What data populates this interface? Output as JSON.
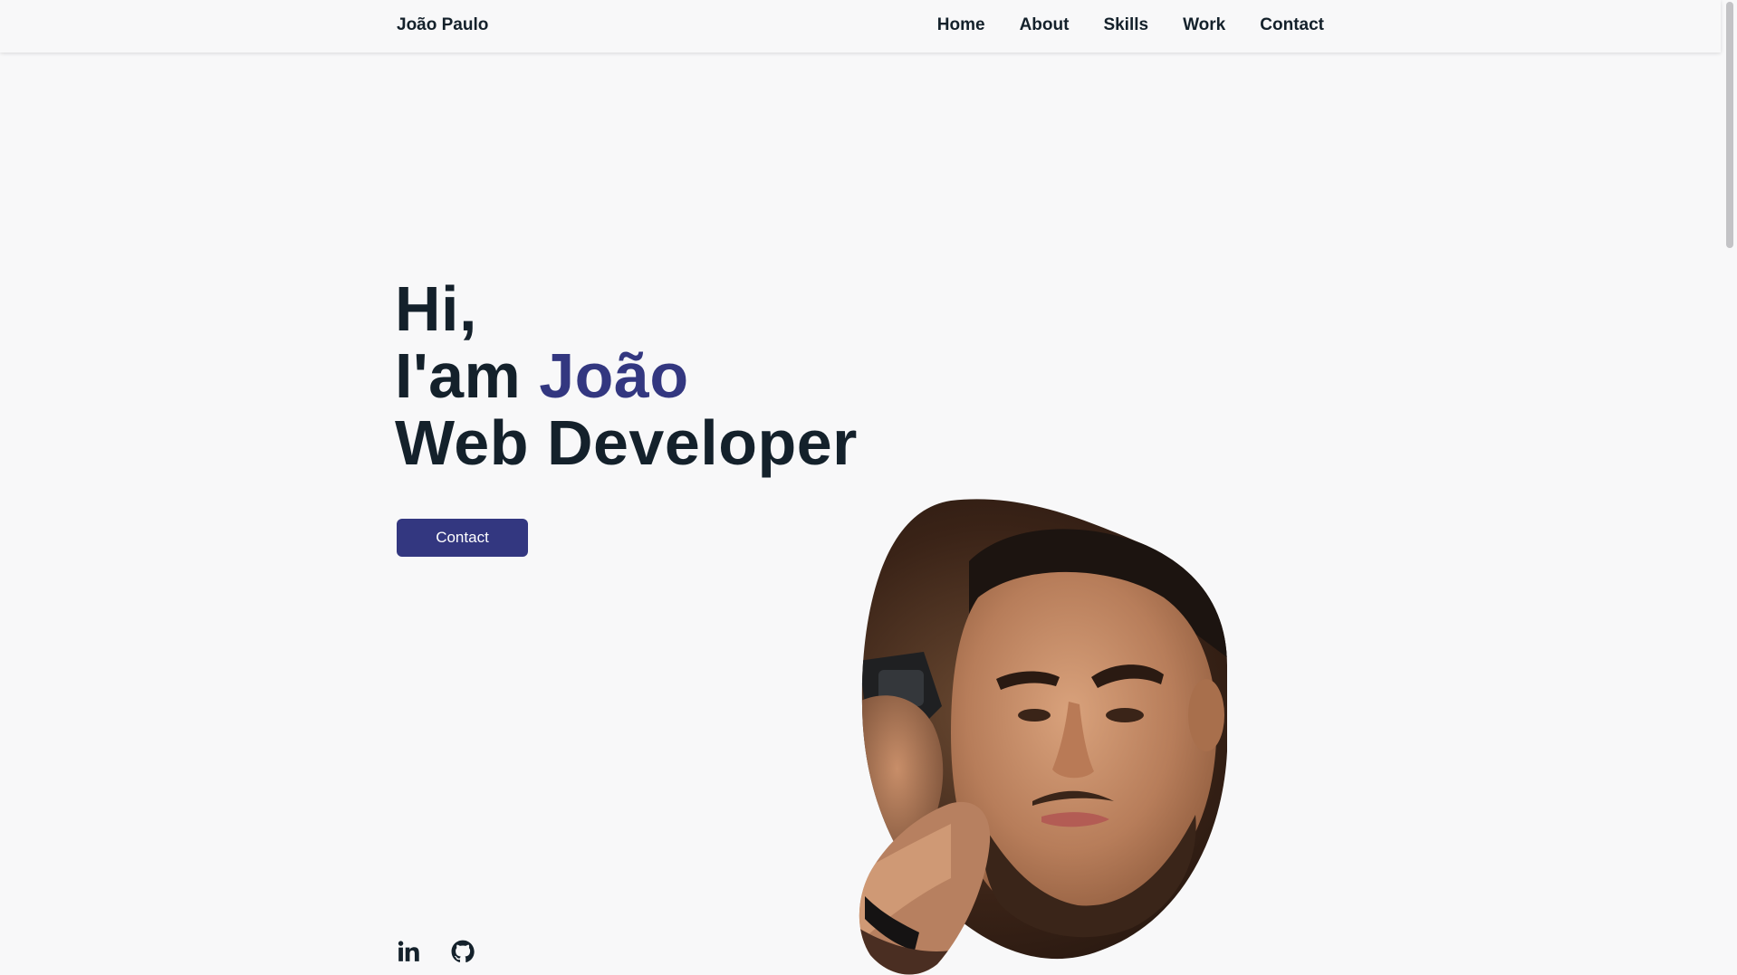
{
  "header": {
    "logo": "João Paulo",
    "nav": [
      "Home",
      "About",
      "Skills",
      "Work",
      "Contact"
    ]
  },
  "hero": {
    "greeting": "Hi,",
    "intro_prefix": "I'am ",
    "name": "João",
    "role": "Web Developer",
    "button_label": "Contact"
  },
  "social": {
    "icons": [
      "linkedin-icon",
      "github-icon"
    ]
  },
  "photo": {
    "icon": "portrait-photo"
  },
  "colors": {
    "background": "#f8f8f9",
    "text": "#14212b",
    "accent": "#333780",
    "button_text": "#ffffff"
  }
}
